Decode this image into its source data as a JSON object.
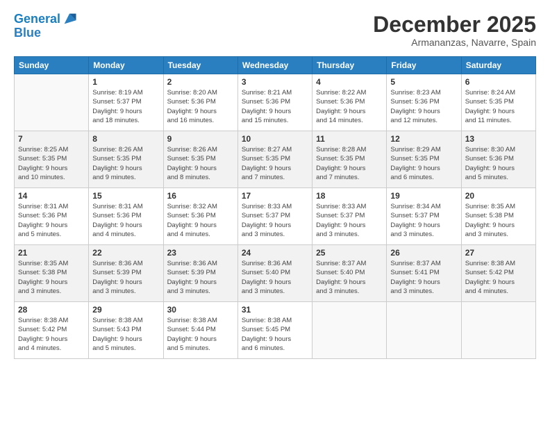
{
  "header": {
    "logo_line1": "General",
    "logo_line2": "Blue",
    "month": "December 2025",
    "location": "Armananzas, Navarre, Spain"
  },
  "weekdays": [
    "Sunday",
    "Monday",
    "Tuesday",
    "Wednesday",
    "Thursday",
    "Friday",
    "Saturday"
  ],
  "weeks": [
    [
      {
        "day": "",
        "info": ""
      },
      {
        "day": "1",
        "info": "Sunrise: 8:19 AM\nSunset: 5:37 PM\nDaylight: 9 hours\nand 18 minutes."
      },
      {
        "day": "2",
        "info": "Sunrise: 8:20 AM\nSunset: 5:36 PM\nDaylight: 9 hours\nand 16 minutes."
      },
      {
        "day": "3",
        "info": "Sunrise: 8:21 AM\nSunset: 5:36 PM\nDaylight: 9 hours\nand 15 minutes."
      },
      {
        "day": "4",
        "info": "Sunrise: 8:22 AM\nSunset: 5:36 PM\nDaylight: 9 hours\nand 14 minutes."
      },
      {
        "day": "5",
        "info": "Sunrise: 8:23 AM\nSunset: 5:36 PM\nDaylight: 9 hours\nand 12 minutes."
      },
      {
        "day": "6",
        "info": "Sunrise: 8:24 AM\nSunset: 5:35 PM\nDaylight: 9 hours\nand 11 minutes."
      }
    ],
    [
      {
        "day": "7",
        "info": "Sunrise: 8:25 AM\nSunset: 5:35 PM\nDaylight: 9 hours\nand 10 minutes."
      },
      {
        "day": "8",
        "info": "Sunrise: 8:26 AM\nSunset: 5:35 PM\nDaylight: 9 hours\nand 9 minutes."
      },
      {
        "day": "9",
        "info": "Sunrise: 8:26 AM\nSunset: 5:35 PM\nDaylight: 9 hours\nand 8 minutes."
      },
      {
        "day": "10",
        "info": "Sunrise: 8:27 AM\nSunset: 5:35 PM\nDaylight: 9 hours\nand 7 minutes."
      },
      {
        "day": "11",
        "info": "Sunrise: 8:28 AM\nSunset: 5:35 PM\nDaylight: 9 hours\nand 7 minutes."
      },
      {
        "day": "12",
        "info": "Sunrise: 8:29 AM\nSunset: 5:35 PM\nDaylight: 9 hours\nand 6 minutes."
      },
      {
        "day": "13",
        "info": "Sunrise: 8:30 AM\nSunset: 5:36 PM\nDaylight: 9 hours\nand 5 minutes."
      }
    ],
    [
      {
        "day": "14",
        "info": "Sunrise: 8:31 AM\nSunset: 5:36 PM\nDaylight: 9 hours\nand 5 minutes."
      },
      {
        "day": "15",
        "info": "Sunrise: 8:31 AM\nSunset: 5:36 PM\nDaylight: 9 hours\nand 4 minutes."
      },
      {
        "day": "16",
        "info": "Sunrise: 8:32 AM\nSunset: 5:36 PM\nDaylight: 9 hours\nand 4 minutes."
      },
      {
        "day": "17",
        "info": "Sunrise: 8:33 AM\nSunset: 5:37 PM\nDaylight: 9 hours\nand 3 minutes."
      },
      {
        "day": "18",
        "info": "Sunrise: 8:33 AM\nSunset: 5:37 PM\nDaylight: 9 hours\nand 3 minutes."
      },
      {
        "day": "19",
        "info": "Sunrise: 8:34 AM\nSunset: 5:37 PM\nDaylight: 9 hours\nand 3 minutes."
      },
      {
        "day": "20",
        "info": "Sunrise: 8:35 AM\nSunset: 5:38 PM\nDaylight: 9 hours\nand 3 minutes."
      }
    ],
    [
      {
        "day": "21",
        "info": "Sunrise: 8:35 AM\nSunset: 5:38 PM\nDaylight: 9 hours\nand 3 minutes."
      },
      {
        "day": "22",
        "info": "Sunrise: 8:36 AM\nSunset: 5:39 PM\nDaylight: 9 hours\nand 3 minutes."
      },
      {
        "day": "23",
        "info": "Sunrise: 8:36 AM\nSunset: 5:39 PM\nDaylight: 9 hours\nand 3 minutes."
      },
      {
        "day": "24",
        "info": "Sunrise: 8:36 AM\nSunset: 5:40 PM\nDaylight: 9 hours\nand 3 minutes."
      },
      {
        "day": "25",
        "info": "Sunrise: 8:37 AM\nSunset: 5:40 PM\nDaylight: 9 hours\nand 3 minutes."
      },
      {
        "day": "26",
        "info": "Sunrise: 8:37 AM\nSunset: 5:41 PM\nDaylight: 9 hours\nand 3 minutes."
      },
      {
        "day": "27",
        "info": "Sunrise: 8:38 AM\nSunset: 5:42 PM\nDaylight: 9 hours\nand 4 minutes."
      }
    ],
    [
      {
        "day": "28",
        "info": "Sunrise: 8:38 AM\nSunset: 5:42 PM\nDaylight: 9 hours\nand 4 minutes."
      },
      {
        "day": "29",
        "info": "Sunrise: 8:38 AM\nSunset: 5:43 PM\nDaylight: 9 hours\nand 5 minutes."
      },
      {
        "day": "30",
        "info": "Sunrise: 8:38 AM\nSunset: 5:44 PM\nDaylight: 9 hours\nand 5 minutes."
      },
      {
        "day": "31",
        "info": "Sunrise: 8:38 AM\nSunset: 5:45 PM\nDaylight: 9 hours\nand 6 minutes."
      },
      {
        "day": "",
        "info": ""
      },
      {
        "day": "",
        "info": ""
      },
      {
        "day": "",
        "info": ""
      }
    ]
  ]
}
